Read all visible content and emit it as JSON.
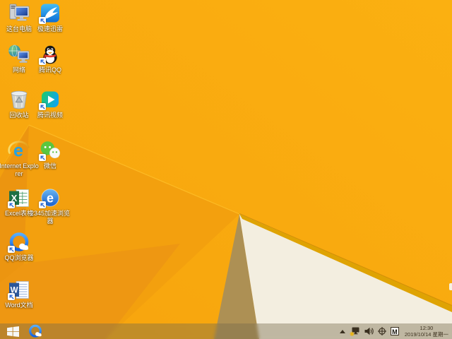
{
  "desktop": {
    "icons": [
      {
        "id": "this-pc",
        "label": "这台电脑",
        "shortcut": false
      },
      {
        "id": "xunlei",
        "label": "极速迅雷",
        "shortcut": true
      },
      {
        "id": "network",
        "label": "网络",
        "shortcut": false
      },
      {
        "id": "tencent-qq",
        "label": "腾讯QQ",
        "shortcut": true
      },
      {
        "id": "recycle-bin",
        "label": "回收站",
        "shortcut": false
      },
      {
        "id": "tencent-video",
        "label": "腾讯视频",
        "shortcut": true
      },
      {
        "id": "internet-explorer",
        "label": "Internet Explorer",
        "shortcut": false
      },
      {
        "id": "wechat",
        "label": "微信",
        "shortcut": true
      },
      {
        "id": "excel",
        "label": "Excel表格",
        "shortcut": true
      },
      {
        "id": "browser-2345",
        "label": "2345加速浏览器",
        "shortcut": true
      },
      {
        "id": "qq-browser",
        "label": "QQ浏览器",
        "shortcut": true
      },
      {
        "id": "word",
        "label": "Word文档",
        "shortcut": true
      }
    ]
  },
  "taskbar": {
    "pinned": [
      {
        "id": "qq-browser-taskbar"
      }
    ],
    "tray": {
      "icon_names": [
        "hidden-icons-chevron",
        "network-warning",
        "volume",
        "crosshair",
        "input-method"
      ],
      "input_letter": "M"
    },
    "clock": {
      "time": "12:30",
      "date": "2019/10/14 星期一"
    }
  },
  "colors": {
    "wallpaper_orange": "#FAAD10",
    "wallpaper_orange_mid": "#F3A00E",
    "wallpaper_orange_dark": "#EC9510",
    "facet_tan": "#AD9054",
    "facet_white": "#F3EEE0",
    "gold_edge": "#DFA303",
    "taskbar_tint": "#76664C",
    "icon_label_text": "#FFFFFF",
    "clock_text": "#3F3320"
  }
}
